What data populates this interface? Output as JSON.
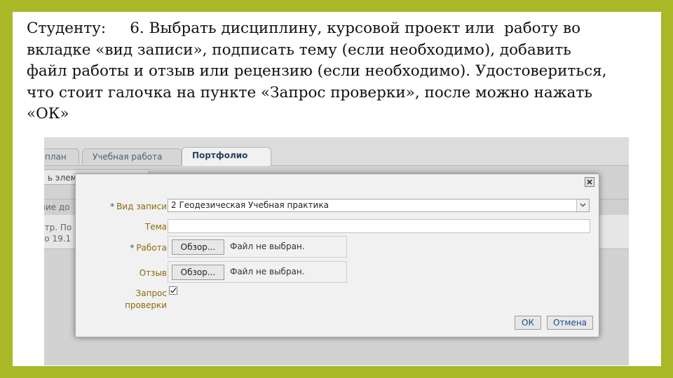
{
  "instruction": {
    "lines": [
      "Студенту:     6. Выбрать дисциплину, курсовой проект или  работу во",
      "вкладке «вид записи», подписать тему (если необходимо), добавить",
      "файл работы и отзыв или рецензию (если необходимо). Удостовериться,",
      "что стоит галочка на пункте «Запрос проверки», после можно нажать",
      "«ОК»"
    ]
  },
  "background": {
    "tabs": [
      "план",
      "Учебная работа",
      "Портфолио"
    ],
    "add_button": "ь элем",
    "column_header": "ние до",
    "row_text": [
      "стр. По",
      "го 19.1"
    ]
  },
  "dialog": {
    "entry_type": {
      "required": "*",
      "label": "Вид записи",
      "value": "2 Геодезическая Учебная практика"
    },
    "topic": {
      "label": "Тема",
      "value": ""
    },
    "work": {
      "required": "*",
      "label": "Работа",
      "browse": "Обзор...",
      "status": "Файл не выбран."
    },
    "review": {
      "label": "Отзыв",
      "browse": "Обзор...",
      "status": "Файл не выбран."
    },
    "check_request": {
      "label": "Запрос\nпроверки",
      "checked": true
    },
    "ok": "ОК",
    "cancel": "Отмена"
  },
  "colors": {
    "frame": "#a8b827",
    "label": "#8a6a0a",
    "required": "#2f4f86",
    "button_text": "#1d4a8f"
  },
  "icons": [
    "close-icon",
    "chevron-down-icon",
    "checkmark-icon"
  ]
}
